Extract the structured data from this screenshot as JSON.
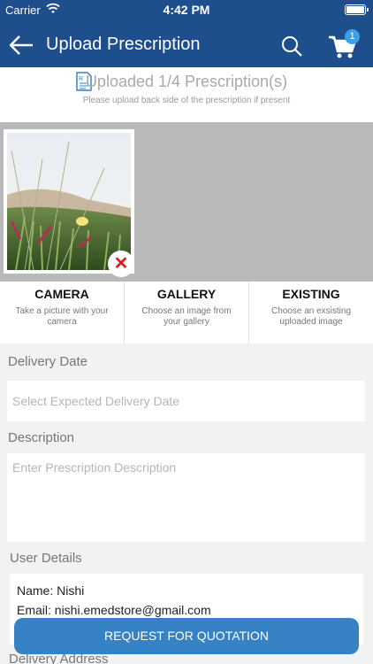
{
  "status_bar": {
    "carrier": "Carrier",
    "time": "4:42 PM"
  },
  "header": {
    "title": "Upload Prescription",
    "cart_count": "1",
    "icons": [
      "back-arrow-icon",
      "search-icon",
      "cart-icon"
    ]
  },
  "upload_status": {
    "title": "Uploaded 1/4 Prescription(s)",
    "subtitle": "Please upload back side of the prescription if present"
  },
  "thumbnail": {
    "remove_glyph": "✕"
  },
  "options": [
    {
      "label": "CAMERA",
      "description": "Take a picture with your camera"
    },
    {
      "label": "GALLERY",
      "description": "Choose an image from your gallery"
    },
    {
      "label": "EXISTING",
      "description": "Choose an exsisting uploaded image"
    }
  ],
  "form": {
    "delivery_date_label": "Delivery Date",
    "delivery_date_placeholder": "Select Expected Delivery Date",
    "description_label": "Description",
    "description_placeholder": "Enter Prescription Description",
    "user_details_label": "User Details",
    "user_name": "Name: Nishi",
    "user_email": "Email: nishi.emedstore@gmail.com",
    "delivery_address_label": "Delivery Address"
  },
  "actions": {
    "request_quote": "REQUEST FOR QUOTATION"
  },
  "colors": {
    "header": "#1f4e8c",
    "accent": "#3682c4",
    "remove": "#d62020"
  }
}
